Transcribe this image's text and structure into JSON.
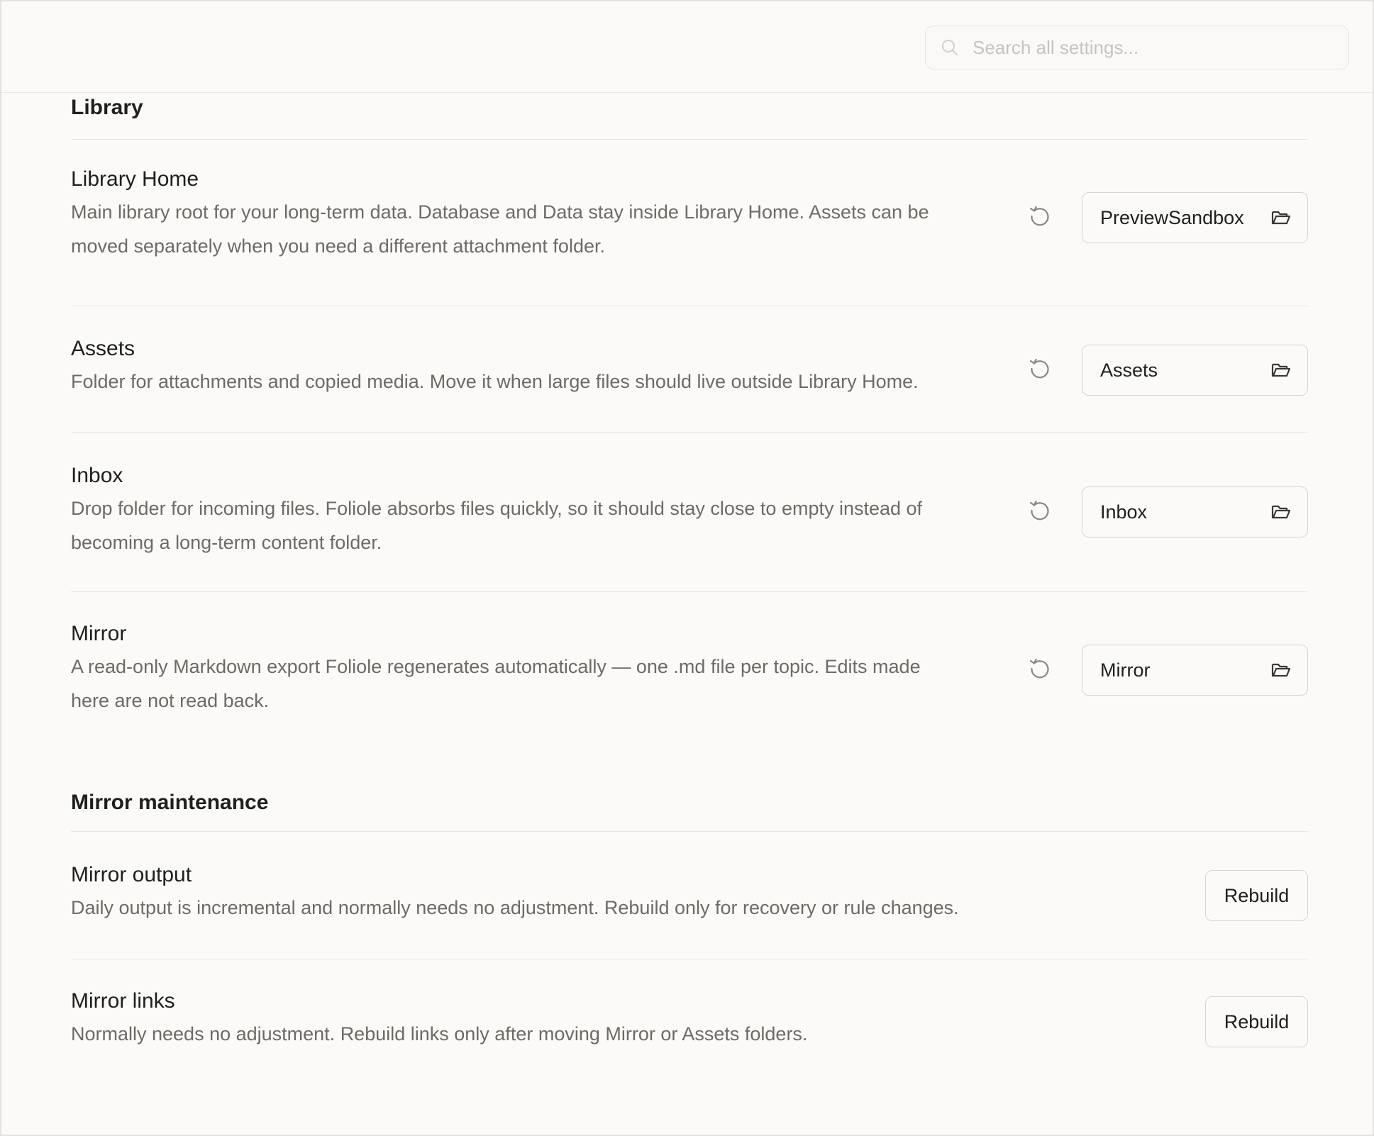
{
  "search": {
    "placeholder": "Search all settings..."
  },
  "sections": {
    "library": {
      "title": "Library",
      "rows": [
        {
          "name": "Library Home",
          "desc_line1": "Main library root for your long-term data. Database and Data stay inside Library Home. Assets can be",
          "desc_line2": "moved separately when you need a different attachment folder.",
          "value": "PreviewSandbox"
        },
        {
          "name": "Assets",
          "desc_line1": "Folder for attachments and copied media. Move it when large files should live outside Library Home.",
          "value": "Assets"
        },
        {
          "name": "Inbox",
          "desc_line1": "Drop folder for incoming files. Foliole absorbs files quickly, so it should stay close to empty instead of",
          "desc_line2": "becoming a long-term content folder.",
          "value": "Inbox"
        },
        {
          "name": "Mirror",
          "desc_line1": "A read-only Markdown export Foliole regenerates automatically — one .md file per topic. Edits made",
          "desc_line2": "here are not read back.",
          "value": "Mirror"
        }
      ]
    },
    "maintenance": {
      "title": "Mirror maintenance",
      "rows": [
        {
          "name": "Mirror output",
          "desc_line1": "Daily output is incremental and normally needs no adjustment. Rebuild only for recovery or rule changes.",
          "button": "Rebuild"
        },
        {
          "name": "Mirror links",
          "desc_line1": "Normally needs no adjustment. Rebuild links only after moving Mirror or Assets folders.",
          "button": "Rebuild"
        }
      ]
    }
  },
  "icons": {
    "search": "search-icon",
    "reset": "reset-icon",
    "folder": "folder-open-icon"
  },
  "colors": {
    "background": "#fbfaf8",
    "text": "#1f1f1f",
    "muted_text": "#6e6a65",
    "border": "#d8d5d0",
    "divider": "#e8e6e2"
  }
}
